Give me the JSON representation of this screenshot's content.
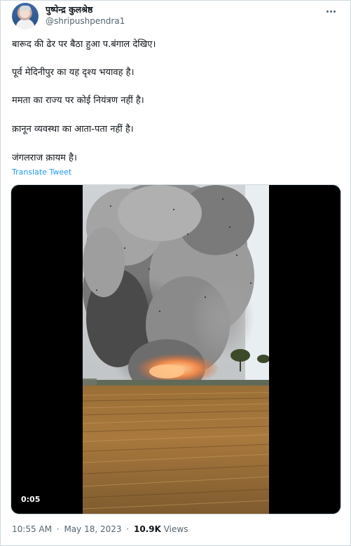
{
  "author": {
    "display_name": "पुष्पेन्द्र कुलश्रेष्ठ",
    "handle": "@shripushpendra1"
  },
  "more_icon": "more-horizontal-icon",
  "tweet": {
    "lines": [
      "बारूद की ढेर पर बैठा हुआ प.बंगाल देखिए।",
      "पूर्व मेदिनीपुर का यह दृश्य भयावह है।",
      "ममता का राज्य पर कोई नियंत्रण नहीं है।",
      "क़ानून व्यवस्था का आता-पता नहीं है।",
      "जंगलराज क़ायम है।"
    ],
    "translate_label": "Translate Tweet"
  },
  "media": {
    "duration": "0:05",
    "description_icon": "video-thumbnail"
  },
  "footer": {
    "time": "10:55 AM",
    "separator": "·",
    "date": "May 18, 2023",
    "views_count": "10.9K",
    "views_label": "Views"
  },
  "colors": {
    "link": "#1d9bf0",
    "secondary_text": "#536471",
    "primary_text": "#0f1419",
    "border": "#cfd9de"
  }
}
